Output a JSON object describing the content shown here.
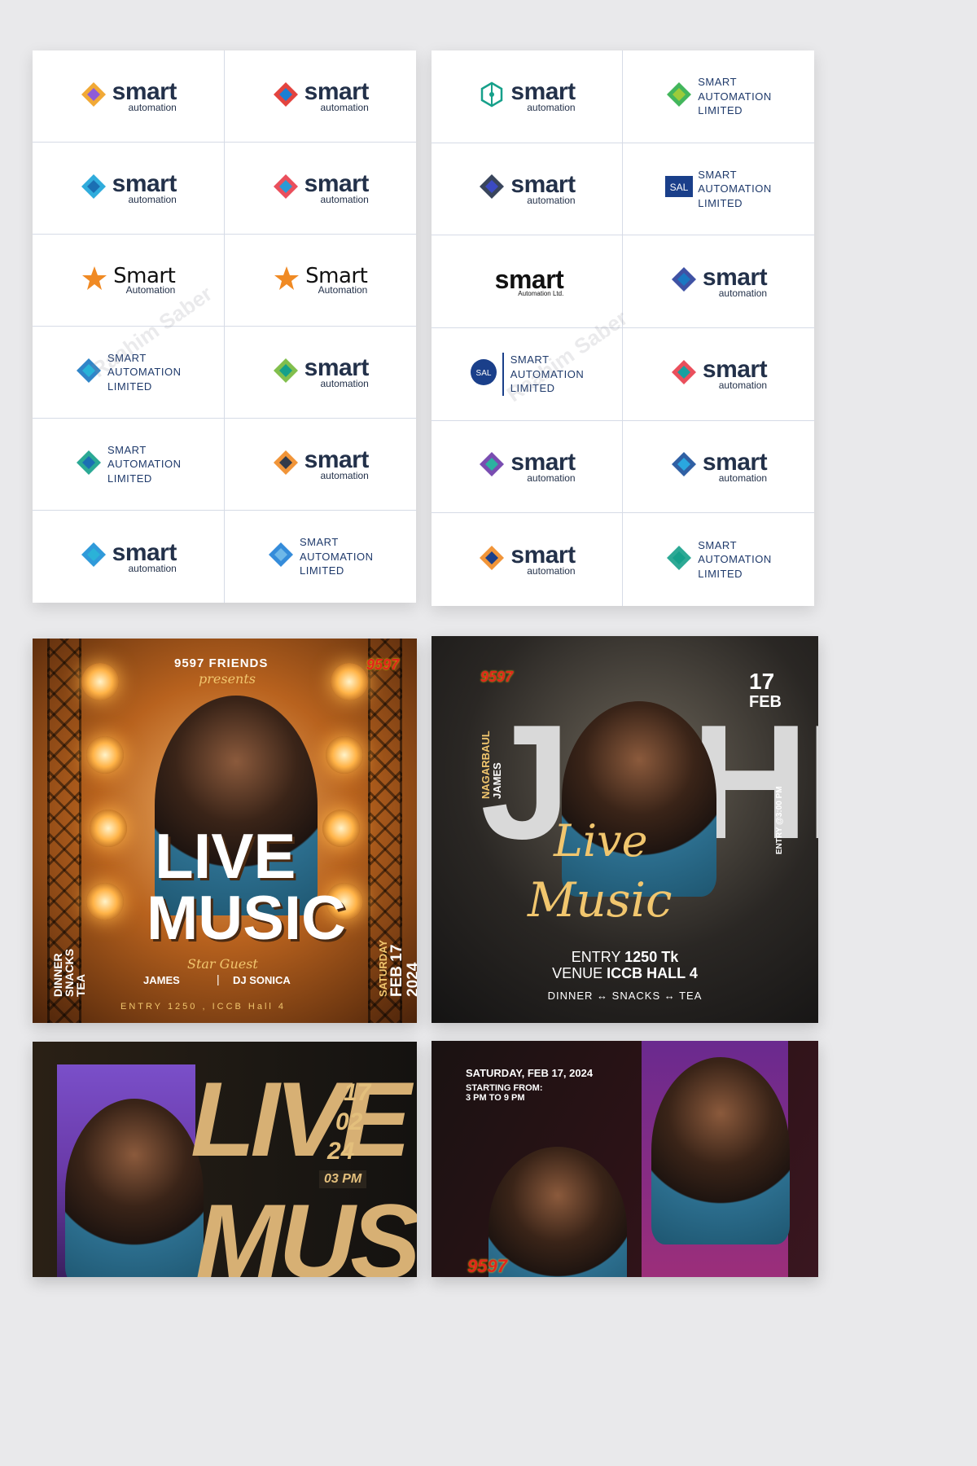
{
  "watermark": "Raahim Saber",
  "logos_left": [
    {
      "big": "smart",
      "small": "automation",
      "icon": "cube-icon"
    },
    {
      "big": "smart",
      "small": "automation",
      "icon": "sa-monogram-icon"
    },
    {
      "big": "smart",
      "small": "automation",
      "icon": "square-blocks-icon"
    },
    {
      "big": "smart",
      "small": "automation",
      "icon": "s-ribbon-icon"
    },
    {
      "big": "Smart",
      "small": "Automation",
      "icon": "star-icon"
    },
    {
      "big": "Smart",
      "small": "Automation",
      "icon": "star-icon"
    },
    {
      "lines": [
        "SMART",
        "AUTOMATION",
        "LIMITED"
      ],
      "icon": "square-frame-icon"
    },
    {
      "big": "smart",
      "small": "automation",
      "icon": "diamond-weave-icon"
    },
    {
      "lines": [
        "SMART",
        "AUTOMATION",
        "LIMITED"
      ],
      "icon": "leaf-s-icon"
    },
    {
      "big": "smart",
      "small": "automation",
      "icon": "arrows-s-icon"
    },
    {
      "big": "smart",
      "small": "automation",
      "icon": "check-diamond-icon"
    },
    {
      "lines": [
        "SMART",
        "AUTOMATION",
        "LIMITED"
      ],
      "icon": "diamond-arc-icon"
    }
  ],
  "logos_right": [
    {
      "big": "smart",
      "small": "automation",
      "icon": "network-hex-icon"
    },
    {
      "lines": [
        "SMART",
        "AUTOMATION",
        "LIMITED"
      ],
      "icon": "square-maze-icon"
    },
    {
      "big": "smart",
      "small": "automation",
      "icon": "s-chevron-icon"
    },
    {
      "badge": "SAL",
      "lines": [
        "SMART",
        "AUTOMATION",
        "LIMITED"
      ],
      "icon": "sal-box-icon"
    },
    {
      "big": "smart",
      "small": "Automation Ltd.",
      "icon": "wifi-dot-icon"
    },
    {
      "big": "smart",
      "small": "automation",
      "icon": "sa-stripes-icon"
    },
    {
      "badge": "SAL",
      "lines": [
        "SMART",
        "AUTOMATION",
        "LIMITED"
      ],
      "icon": "sal-circle-icon"
    },
    {
      "big": "smart",
      "small": "automation",
      "icon": "s-triangles-icon"
    },
    {
      "big": "smart",
      "small": "automation",
      "icon": "layered-diamond-icon"
    },
    {
      "big": "smart",
      "small": "automation",
      "icon": "s-blocks-icon"
    },
    {
      "big": "smart",
      "small": "automation",
      "icon": "hex-arrows-icon"
    },
    {
      "lines": [
        "SMART",
        "AUTOMATION",
        "LIMITED"
      ],
      "icon": "s-zigzag-icon"
    }
  ],
  "poster1": {
    "presenter": "9597 FRIENDS",
    "presents": "presents",
    "brand": "9597",
    "headline1": "LIVE",
    "headline2": "MUSIC",
    "star_guest": "Star Guest",
    "artist1": "JAMES",
    "sep": "|",
    "artist2": "DJ SONICA",
    "left_side": [
      "DINNER",
      "SNACKS",
      "TEA"
    ],
    "day": "SATURDAY",
    "date": "FEB 17 2024",
    "footer": "ENTRY 1250 , ICCB Hall 4"
  },
  "poster2": {
    "brand": "9597",
    "day": "17",
    "month": "FEB",
    "vertical_name": [
      "NAGARBAUL",
      "JAMES"
    ],
    "big_name": "JOHN",
    "entry_time": "ENTRY @3:00 PM",
    "script1": "Live",
    "script2": "Music",
    "entry_label": "ENTRY",
    "entry_value": "1250 Tk",
    "venue_label": "VENUE",
    "venue_value": "ICCB HALL 4",
    "extras": "DINNER ↔ SNACKS ↔ TEA"
  },
  "poster3": {
    "headline1": "LIVE",
    "headline2": "MUSIC",
    "d1": "17",
    "d2": "02",
    "d3": "24",
    "time": "03 PM"
  },
  "poster4": {
    "date": "SATURDAY, FEB 17, 2024",
    "start_label": "STARTING FROM:",
    "start_value": "3 PM TO 9 PM",
    "brand": "9597"
  },
  "colors": {
    "navy": "#23314a",
    "blue": "#1f7fd6",
    "teal": "#0f8f7a",
    "orange": "#f08a24"
  }
}
